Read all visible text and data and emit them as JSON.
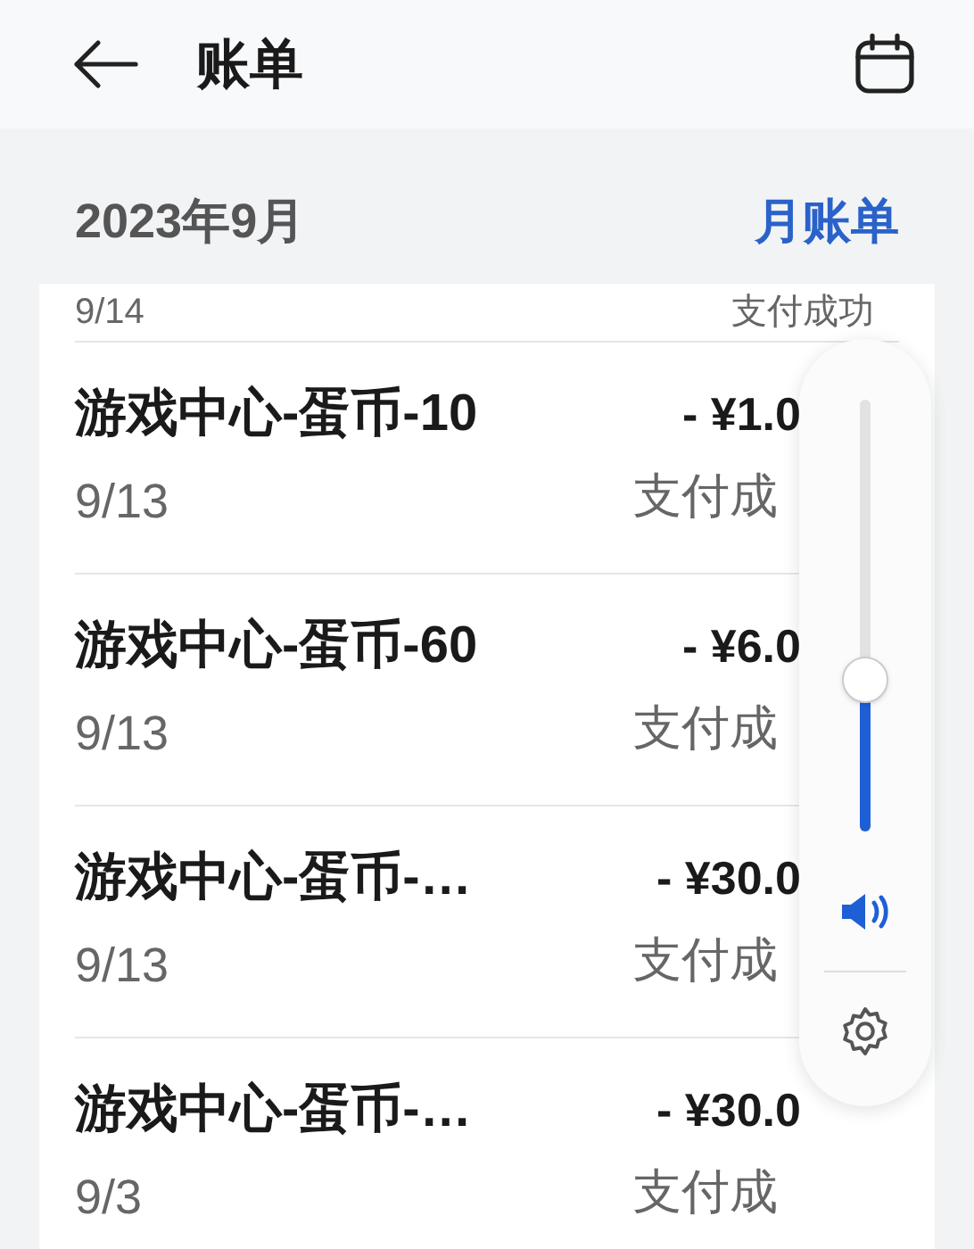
{
  "header": {
    "title": "账单"
  },
  "month": {
    "label": "2023年9月",
    "link": "月账单"
  },
  "bills": [
    {
      "date": "9/14",
      "status": "支付成功"
    },
    {
      "title": "游戏中心-蛋币-10",
      "date": "9/13",
      "amount": "- ¥1.0",
      "status": "支付成"
    },
    {
      "title": "游戏中心-蛋币-60",
      "date": "9/13",
      "amount": "- ¥6.0",
      "status": "支付成"
    },
    {
      "title": "游戏中心-蛋币-…",
      "date": "9/13",
      "amount": "- ¥30.0",
      "status": "支付成"
    },
    {
      "title": "游戏中心-蛋币-…",
      "date": "9/3",
      "amount": "- ¥30.0",
      "status": "支付成"
    }
  ],
  "volume": {
    "level": 0.35
  }
}
